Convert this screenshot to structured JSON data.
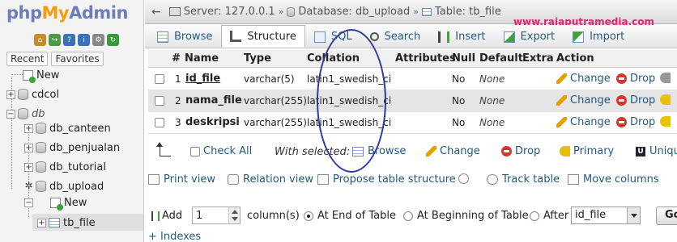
{
  "sidebar": {
    "logo": {
      "php": "php",
      "my": "My",
      "admin": "Admin"
    },
    "tabs": [
      "Recent",
      "Favorites"
    ],
    "tree": [
      {
        "label": "New",
        "type": "new"
      },
      {
        "label": "cdcol",
        "type": "db"
      },
      {
        "label": "db",
        "type": "db",
        "italic": true
      },
      {
        "label": "db_canteen",
        "type": "db"
      },
      {
        "label": "db_penjualan",
        "type": "db"
      },
      {
        "label": "db_tutorial",
        "type": "db"
      },
      {
        "label": "db_upload",
        "type": "db"
      },
      {
        "label": "New",
        "type": "new"
      },
      {
        "label": "tb_file",
        "type": "table"
      }
    ]
  },
  "breadcrumb": {
    "server": "Server: 127.0.0.1",
    "database": "Database: db_upload",
    "table": "Table: tb_file"
  },
  "watermark": "www.rajaputramedia.com",
  "tabs": [
    "Browse",
    "Structure",
    "SQL",
    "Search",
    "Insert",
    "Export",
    "Import"
  ],
  "columns": [
    "#",
    "Name",
    "Type",
    "Collation",
    "Attributes",
    "Null",
    "Default",
    "Extra",
    "Action"
  ],
  "rows": [
    {
      "num": "1",
      "name": "id_file",
      "type": "varchar(5)",
      "collation": "latin1_swedish_ci",
      "null": "No",
      "default": "None"
    },
    {
      "num": "2",
      "name": "nama_file",
      "type": "varchar(255)",
      "collation": "latin1_swedish_ci",
      "null": "No",
      "default": "None"
    },
    {
      "num": "3",
      "name": "deskripsi",
      "type": "varchar(255)",
      "collation": "latin1_swedish_ci",
      "null": "No",
      "default": "None"
    }
  ],
  "row_actions": {
    "change": "Change",
    "drop": "Drop"
  },
  "with_selected": {
    "check_all": "Check All",
    "label": "With selected:",
    "browse": "Browse",
    "change": "Change",
    "drop": "Drop",
    "primary": "Primary",
    "unique": "Uniqu"
  },
  "tools": {
    "print": "Print view",
    "relation": "Relation view",
    "propose": "Propose table structure",
    "track": "Track table",
    "move": "Move columns"
  },
  "add": {
    "label": "Add",
    "count": "1",
    "columns": "column(s)",
    "at_end": "At End of Table",
    "at_beginning": "At Beginning of Table",
    "after": "After",
    "after_field": "id_file",
    "go": "Go"
  },
  "indexes": "+ Indexes"
}
